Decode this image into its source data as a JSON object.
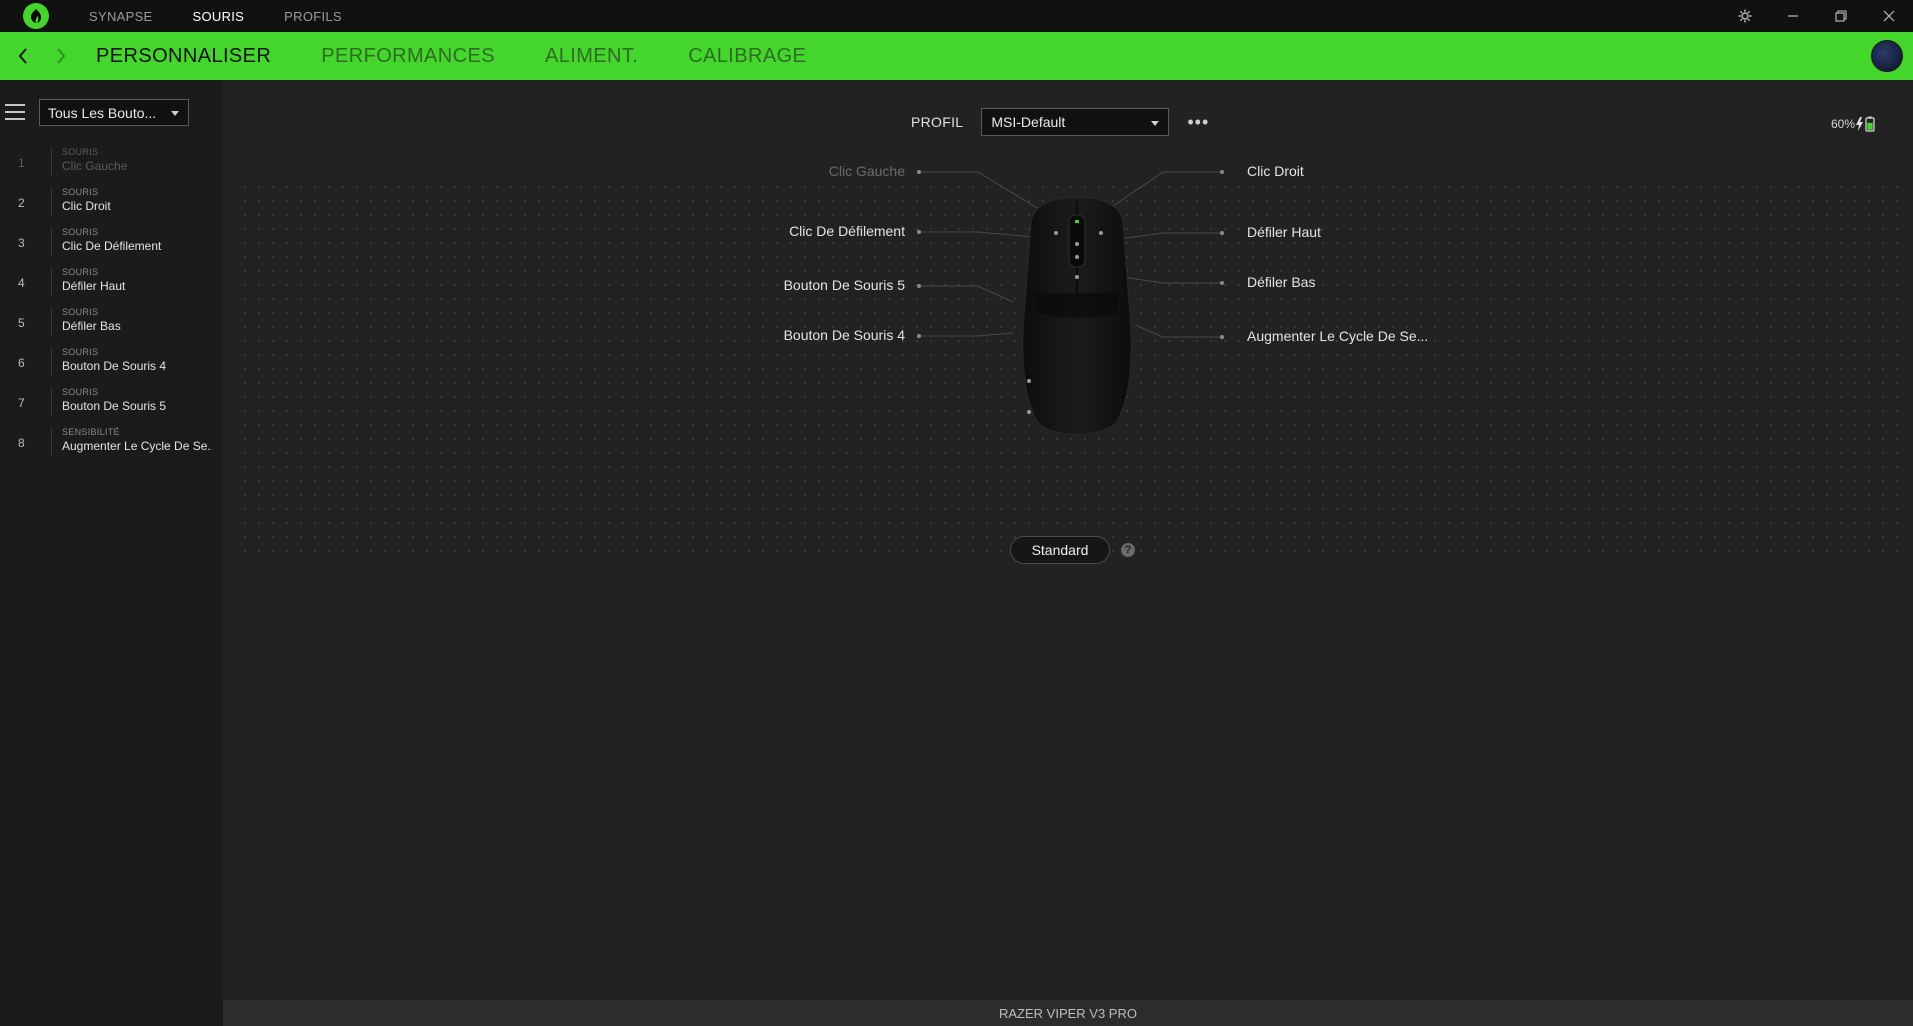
{
  "titlebar": {
    "tabs": [
      {
        "label": "SYNAPSE",
        "active": false
      },
      {
        "label": "SOURIS",
        "active": true
      },
      {
        "label": "PROFILS",
        "active": false
      }
    ]
  },
  "nav": {
    "tabs": [
      {
        "label": "PERSONNALISER",
        "active": true
      },
      {
        "label": "PERFORMANCES",
        "active": false
      },
      {
        "label": "ALIMENT.",
        "active": false
      },
      {
        "label": "CALIBRAGE",
        "active": false
      }
    ]
  },
  "sidebar": {
    "filter_value": "Tous Les Bouto...",
    "items": [
      {
        "num": "1",
        "category": "SOURIS",
        "label": "Clic Gauche",
        "dim": true
      },
      {
        "num": "2",
        "category": "SOURIS",
        "label": "Clic Droit",
        "dim": false
      },
      {
        "num": "3",
        "category": "SOURIS",
        "label": "Clic De Défilement",
        "dim": false
      },
      {
        "num": "4",
        "category": "SOURIS",
        "label": "Défiler Haut",
        "dim": false
      },
      {
        "num": "5",
        "category": "SOURIS",
        "label": "Défiler  Bas",
        "dim": false
      },
      {
        "num": "6",
        "category": "SOURIS",
        "label": "Bouton De Souris 4",
        "dim": false
      },
      {
        "num": "7",
        "category": "SOURIS",
        "label": "Bouton De Souris 5",
        "dim": false
      },
      {
        "num": "8",
        "category": "SENSIBILITÉ",
        "label": "Augmenter Le Cycle De Se...",
        "dim": false
      }
    ]
  },
  "profile": {
    "label": "PROFIL",
    "value": "MSI-Default",
    "more": "•••"
  },
  "battery": {
    "percent": "60%",
    "level": 0.6,
    "charging": true
  },
  "callouts": {
    "left": [
      {
        "label": "Clic Gauche",
        "dim": true
      },
      {
        "label": "Clic De Défilement",
        "dim": false
      },
      {
        "label": "Bouton De Souris 5",
        "dim": false
      },
      {
        "label": "Bouton De Souris 4",
        "dim": false
      }
    ],
    "right": [
      {
        "label": "Clic Droit",
        "dim": false
      },
      {
        "label": "Défiler Haut",
        "dim": false
      },
      {
        "label": "Défiler  Bas",
        "dim": false
      },
      {
        "label": "Augmenter Le Cycle De Se...",
        "dim": false
      }
    ]
  },
  "mode": {
    "label": "Standard",
    "help": "?"
  },
  "footer": {
    "device": "RAZER VIPER V3 PRO"
  },
  "colors": {
    "accent": "#44d62c",
    "background": "#222222",
    "sidebar": "#1b1b1b"
  }
}
